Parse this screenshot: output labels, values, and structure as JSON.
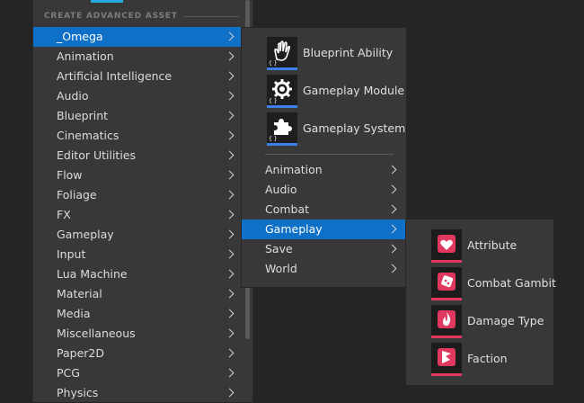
{
  "header": {
    "section_label": "CREATE ADVANCED ASSET"
  },
  "categories": [
    "_Omega",
    "Animation",
    "Artificial Intelligence",
    "Audio",
    "Blueprint",
    "Cinematics",
    "Editor Utilities",
    "Flow",
    "Foliage",
    "FX",
    "Gameplay",
    "Input",
    "Lua Machine",
    "Material",
    "Media",
    "Miscellaneous",
    "Paper2D",
    "PCG",
    "Physics"
  ],
  "omega_menu": {
    "assets": [
      {
        "label": "Blueprint Ability",
        "icon": "hand-icon"
      },
      {
        "label": "Gameplay Module",
        "icon": "gear-icon"
      },
      {
        "label": "Gameplay System",
        "icon": "puzzle-icon"
      }
    ],
    "submenus": [
      "Animation",
      "Audio",
      "Combat",
      "Gameplay",
      "Save",
      "World"
    ]
  },
  "gameplay_menu": {
    "assets": [
      {
        "label": "Attribute",
        "icon": "heart-icon"
      },
      {
        "label": "Combat Gambit",
        "icon": "dice-icon"
      },
      {
        "label": "Damage Type",
        "icon": "fire-icon"
      },
      {
        "label": "Faction",
        "icon": "flag-icon"
      }
    ]
  },
  "colors": {
    "selection": "#0e70c6",
    "accent": "#26a9e0",
    "asset_underline": "#3d7fe6",
    "gameplay_icon": "#e0385e"
  }
}
